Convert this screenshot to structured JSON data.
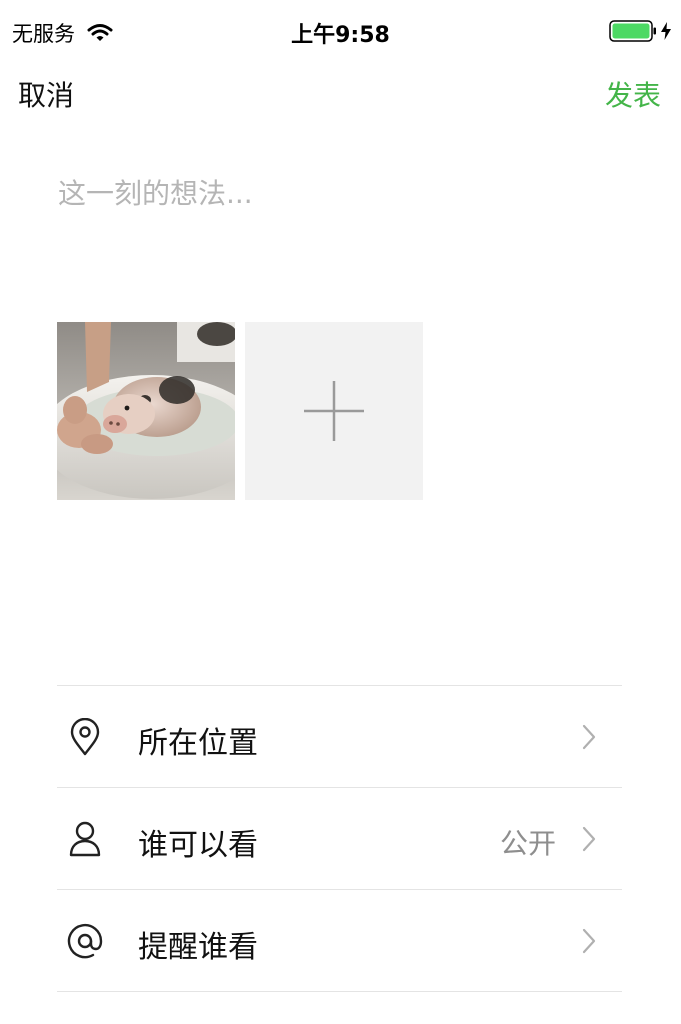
{
  "status_bar": {
    "carrier": "无服务",
    "time": "上午9:58",
    "battery_color": "#4cd964"
  },
  "nav": {
    "cancel_label": "取消",
    "publish_label": "发表",
    "publish_color": "#44b549"
  },
  "composer": {
    "placeholder": "这一刻的想法...",
    "value": ""
  },
  "photos": {
    "items": [
      {
        "icon": "photo-piglet-bath",
        "description_hidden": false
      }
    ],
    "add_icon": "plus-icon"
  },
  "options": [
    {
      "icon": "location-pin-icon",
      "label": "所在位置",
      "value": ""
    },
    {
      "icon": "person-icon",
      "label": "谁可以看",
      "value": "公开"
    },
    {
      "icon": "at-sign-icon",
      "label": "提醒谁看",
      "value": ""
    }
  ]
}
